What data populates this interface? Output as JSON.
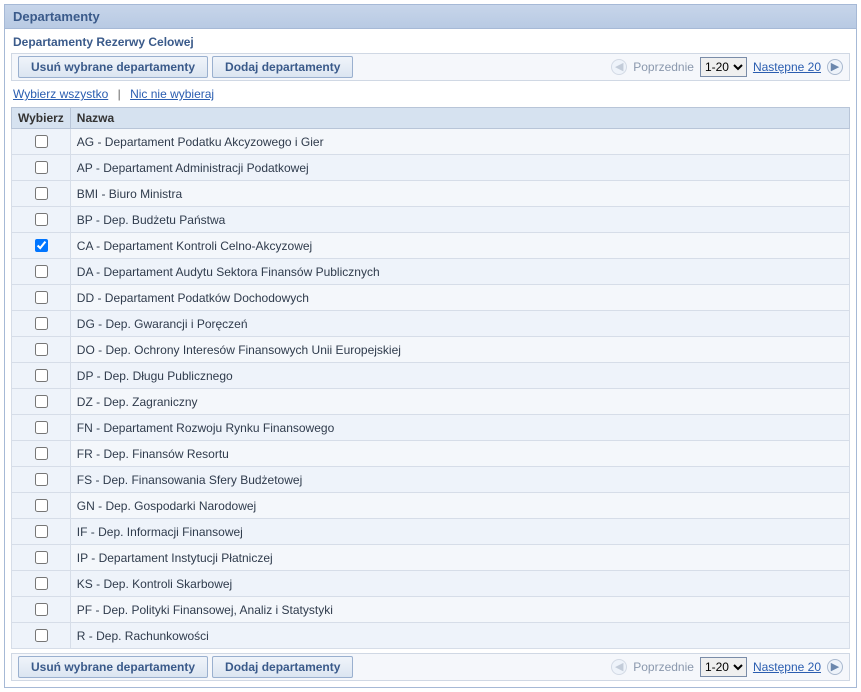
{
  "panel": {
    "title": "Departamenty",
    "subtitle": "Departamenty Rezerwy Celowej"
  },
  "buttons": {
    "delete": "Usuń wybrane departamenty",
    "add": "Dodaj departamenty"
  },
  "pager": {
    "previous": "Poprzednie",
    "range_options": [
      "1-20"
    ],
    "range_selected": "1-20",
    "next": "Następne 20"
  },
  "select_links": {
    "all": "Wybierz wszystko",
    "none": "Nic nie wybieraj"
  },
  "table": {
    "headers": {
      "select": "Wybierz",
      "name": "Nazwa"
    },
    "rows": [
      {
        "checked": false,
        "name": "AG - Departament Podatku Akcyzowego i Gier"
      },
      {
        "checked": false,
        "name": "AP - Departament Administracji Podatkowej"
      },
      {
        "checked": false,
        "name": "BMI - Biuro Ministra"
      },
      {
        "checked": false,
        "name": "BP - Dep. Budżetu Państwa"
      },
      {
        "checked": true,
        "name": "CA - Departament Kontroli Celno-Akcyzowej"
      },
      {
        "checked": false,
        "name": "DA - Departament Audytu Sektora Finansów Publicznych"
      },
      {
        "checked": false,
        "name": "DD - Departament Podatków Dochodowych"
      },
      {
        "checked": false,
        "name": "DG - Dep. Gwarancji i Poręczeń"
      },
      {
        "checked": false,
        "name": "DO - Dep. Ochrony Interesów Finansowych Unii Europejskiej"
      },
      {
        "checked": false,
        "name": "DP - Dep. Długu Publicznego"
      },
      {
        "checked": false,
        "name": "DZ - Dep. Zagraniczny"
      },
      {
        "checked": false,
        "name": "FN - Departament Rozwoju Rynku Finansowego"
      },
      {
        "checked": false,
        "name": "FR - Dep. Finansów Resortu"
      },
      {
        "checked": false,
        "name": "FS - Dep. Finansowania Sfery Budżetowej"
      },
      {
        "checked": false,
        "name": "GN - Dep. Gospodarki Narodowej"
      },
      {
        "checked": false,
        "name": "IF - Dep. Informacji Finansowej"
      },
      {
        "checked": false,
        "name": "IP - Departament Instytucji Płatniczej"
      },
      {
        "checked": false,
        "name": "KS - Dep. Kontroli Skarbowej"
      },
      {
        "checked": false,
        "name": "PF - Dep. Polityki Finansowej, Analiz i Statystyki"
      },
      {
        "checked": false,
        "name": "R - Dep. Rachunkowości"
      }
    ]
  }
}
